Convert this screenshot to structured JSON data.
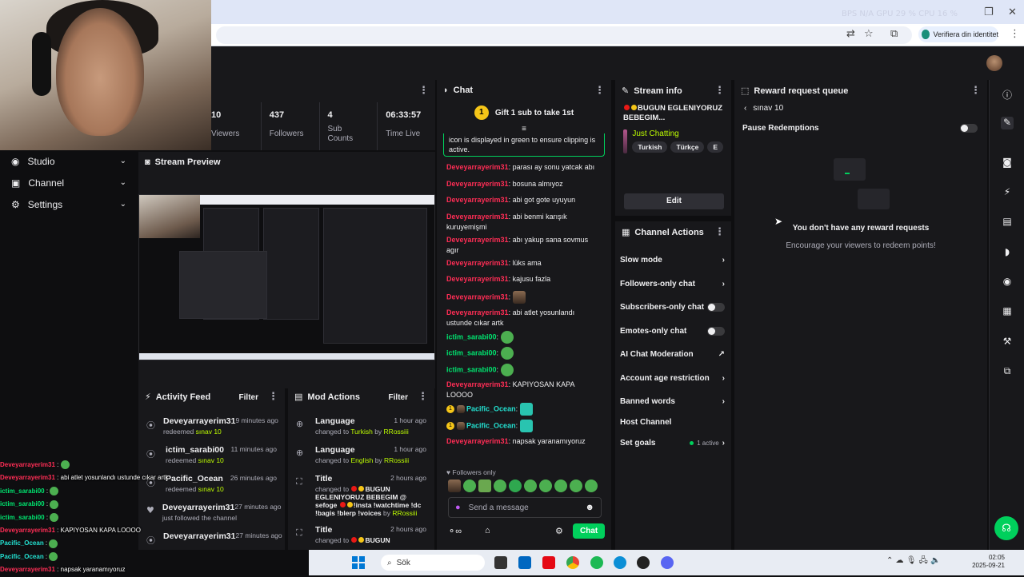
{
  "browser": {
    "overlay_stats": "BPS N/A   GPU 29 %   CPU 16 %",
    "verify_label": "Verifiera din identitet"
  },
  "left_nav": {
    "items": [
      {
        "label": "Studio",
        "icon": "studio-icon"
      },
      {
        "label": "Channel",
        "icon": "channel-icon"
      },
      {
        "label": "Settings",
        "icon": "gear-icon"
      }
    ]
  },
  "stats": [
    {
      "value": "10",
      "label": "Viewers"
    },
    {
      "value": "437",
      "label": "Followers"
    },
    {
      "value": "4",
      "label": "Sub Counts"
    },
    {
      "value": "06:33:57",
      "label": "Time Live"
    }
  ],
  "preview": {
    "title": "Stream Preview"
  },
  "activity": {
    "title": "Activity Feed",
    "filter": "Filter",
    "items": [
      {
        "name": "Deveyarrayerim31",
        "time": "9 minutes ago",
        "sub_prefix": "redeemed ",
        "sub_highlight": "sınav 10"
      },
      {
        "name": "ictim_sarabi00",
        "time": "11 minutes ago",
        "sub_prefix": "redeemed ",
        "sub_highlight": "sınav 10"
      },
      {
        "name": "Pacific_Ocean",
        "time": "26 minutes ago",
        "sub_prefix": "redeemed ",
        "sub_highlight": "sınav 10"
      },
      {
        "name": "Deveyarrayerim31",
        "time": "27 minutes ago",
        "sub_prefix": "just followed the channel",
        "sub_highlight": ""
      },
      {
        "name": "Deveyarrayerim31",
        "time": "27 minutes ago",
        "sub_prefix": "",
        "sub_highlight": ""
      }
    ]
  },
  "mod": {
    "title": "Mod Actions",
    "filter": "Filter",
    "items": [
      {
        "name": "Language",
        "time": "1 hour ago",
        "line1": "changed to ",
        "hl": "Turkish",
        "by": " by ",
        "who": "RRossiii"
      },
      {
        "name": "Language",
        "time": "1 hour ago",
        "line1": "changed to ",
        "hl": "English",
        "by": " by ",
        "who": "RRossiii"
      },
      {
        "name": "Title",
        "time": "2 hours ago",
        "line1": "changed to ",
        "title_text": "BUGUN EGLENIYORUZ BEBEGIM @ sefoge",
        "title_text2": "!insta !watchtime !dc !bagis !blerp !voices",
        "by": " by ",
        "who": "RRossiii"
      },
      {
        "name": "Title",
        "time": "2 hours ago",
        "line1": "changed to ",
        "title_text": "BUGUN"
      }
    ]
  },
  "chat": {
    "title": "Chat",
    "gift_badge": "1",
    "gift_text": "Gift 1 sub to take 1st",
    "pinned_text": "icon is displayed in green to ensure clipping is active.",
    "messages": [
      {
        "user": "Deveyarrayerim31",
        "color": "red",
        "text": "parası ay sonu yatcak abı"
      },
      {
        "user": "Deveyarrayerim31",
        "color": "red",
        "text": "bosuna almıyoz"
      },
      {
        "user": "Deveyarrayerim31",
        "color": "red",
        "text": "abi got gote uyuyun"
      },
      {
        "user": "Deveyarrayerim31",
        "color": "red",
        "text": "abi benmi karışık kuruyemişmi"
      },
      {
        "user": "Deveyarrayerim31",
        "color": "red",
        "text": "abı yakup sana sovmus agır"
      },
      {
        "user": "Deveyarrayerim31",
        "color": "red",
        "text": "lüks ama"
      },
      {
        "user": "Deveyarrayerim31",
        "color": "red",
        "text": "kajusu fazla"
      },
      {
        "user": "Deveyarrayerim31",
        "color": "red",
        "text": ""
      },
      {
        "user": "Deveyarrayerim31",
        "color": "red",
        "text": "abi atlet yosunlandı ustunde cıkar artk"
      },
      {
        "user": "ictim_sarabi00",
        "color": "green",
        "text": ""
      },
      {
        "user": "ictim_sarabi00",
        "color": "green",
        "text": ""
      },
      {
        "user": "ictim_sarabi00",
        "color": "green",
        "text": ""
      },
      {
        "user": "Deveyarrayerim31",
        "color": "red",
        "text": "KAPIYOSAN KAPA LOOOO"
      },
      {
        "user": "Pacific_Ocean",
        "color": "teal",
        "text": ""
      },
      {
        "user": "Pacific_Ocean",
        "color": "teal",
        "text": ""
      },
      {
        "user": "Deveyarrayerim31",
        "color": "red",
        "text": "napsak yaranamıyoruz"
      }
    ],
    "followers_only": "Followers only",
    "input_placeholder": "Send a message",
    "chat_button": "Chat"
  },
  "stream_info": {
    "title": "Stream info",
    "stream_title": "BUGUN EGLENIYORUZ BEBEGIM...",
    "category": "Just Chatting",
    "tags": [
      "Turkish",
      "Türkçe",
      "E"
    ],
    "edit": "Edit"
  },
  "channel_actions": {
    "title": "Channel Actions",
    "items": [
      {
        "label": "Slow mode",
        "ctrl": "chevron"
      },
      {
        "label": "Followers-only chat",
        "ctrl": "chevron"
      },
      {
        "label": "Subscribers-only chat",
        "ctrl": "toggle"
      },
      {
        "label": "Emotes-only chat",
        "ctrl": "toggle"
      },
      {
        "label": "AI Chat Moderation",
        "ctrl": "external"
      },
      {
        "label": "Account age restriction",
        "ctrl": "chevron"
      },
      {
        "label": "Banned words",
        "ctrl": "chevron"
      },
      {
        "label": "Host Channel",
        "ctrl": "none"
      },
      {
        "label": "Set goals",
        "ctrl": "chevron"
      }
    ],
    "goals_active": "1 active"
  },
  "reward_queue": {
    "title": "Reward request queue",
    "back_label": "sınav 10",
    "pause_label": "Pause Redemptions",
    "empty_title": "You don't have any reward requests",
    "empty_sub": "Encourage your viewers to redeem points!"
  },
  "overlay_chat": [
    {
      "user": "Deveyarrayerim31",
      "text": ""
    },
    {
      "user": "Deveyarrayerim31",
      "text": "abi atlet yosunlandı ustunde cıkar artk"
    },
    {
      "user": "ictim_sarabi00",
      "text": ""
    },
    {
      "user": "ictim_sarabi00",
      "text": ""
    },
    {
      "user": "ictim_sarabi00",
      "text": ""
    },
    {
      "user": "Deveyarrayerim31",
      "text": "KAPIYOSAN KAPA LOOOO"
    },
    {
      "user": "Pacific_Ocean",
      "text": ""
    },
    {
      "user": "Pacific_Ocean",
      "text": ""
    },
    {
      "user": "Deveyarrayerim31",
      "text": "napsak yaranamıyoruz"
    }
  ],
  "taskbar": {
    "search": "Sök",
    "time": "02:05",
    "date": "2025-09-21"
  }
}
